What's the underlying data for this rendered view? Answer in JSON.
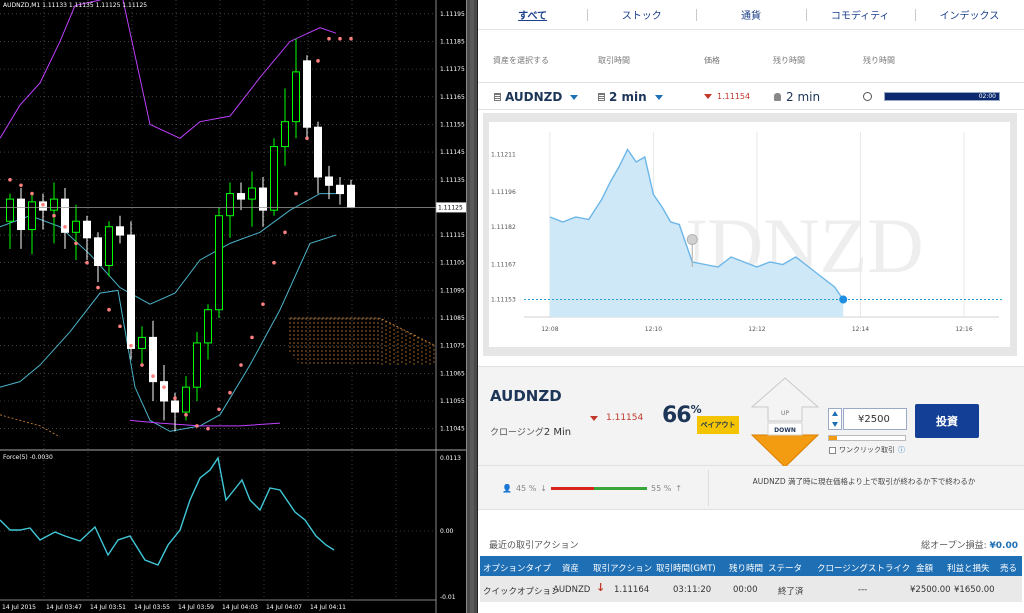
{
  "mt4": {
    "title": "AUDNZD,M1  1.11133 1.11135 1.11125 1.11125",
    "price_axis": [
      "1.11195",
      "1.11185",
      "1.11175",
      "1.11165",
      "1.11155",
      "1.11145",
      "1.11135",
      "1.11115",
      "1.11105",
      "1.11095",
      "1.11085",
      "1.11075",
      "1.11065",
      "1.11055",
      "1.11045"
    ],
    "current_price_tag": "1.11125",
    "indicator_label": "Force(5) -0.0030",
    "indicator_axis": [
      "0.0113",
      "0.00",
      "-0.01"
    ],
    "time_axis": [
      "14 Jul 2015",
      "14 Jul 03:47",
      "14 Jul 03:51",
      "14 Jul 03:55",
      "14 Jul 03:59",
      "14 Jul 04:03",
      "14 Jul 04:07",
      "14 Jul 04:11"
    ],
    "colors": {
      "bull": "#00ff00",
      "bear": "#ffffff",
      "bollinger_upper": "#c040ff",
      "bollinger_mid": "#4bb3c9",
      "sar": "#ff8080",
      "force": "#40c8d8",
      "cloud": "#d98a3a"
    },
    "candles": [
      {
        "o": 1.1112,
        "h": 1.1113,
        "l": 1.1111,
        "c": 1.11128
      },
      {
        "o": 1.11128,
        "h": 1.11132,
        "l": 1.1111,
        "c": 1.11117
      },
      {
        "o": 1.11117,
        "h": 1.1113,
        "l": 1.11108,
        "c": 1.11127
      },
      {
        "o": 1.11127,
        "h": 1.1113,
        "l": 1.11117,
        "c": 1.11124
      },
      {
        "o": 1.11124,
        "h": 1.11134,
        "l": 1.11112,
        "c": 1.11128
      },
      {
        "o": 1.11128,
        "h": 1.11132,
        "l": 1.1111,
        "c": 1.11116
      },
      {
        "o": 1.11116,
        "h": 1.11126,
        "l": 1.11106,
        "c": 1.1112
      },
      {
        "o": 1.1112,
        "h": 1.11122,
        "l": 1.11106,
        "c": 1.11114
      },
      {
        "o": 1.11114,
        "h": 1.11116,
        "l": 1.11098,
        "c": 1.11104
      },
      {
        "o": 1.11104,
        "h": 1.1112,
        "l": 1.111,
        "c": 1.11118
      },
      {
        "o": 1.11118,
        "h": 1.11122,
        "l": 1.11112,
        "c": 1.11115
      },
      {
        "o": 1.11115,
        "h": 1.1112,
        "l": 1.1107,
        "c": 1.11074
      },
      {
        "o": 1.11074,
        "h": 1.11082,
        "l": 1.11068,
        "c": 1.11078
      },
      {
        "o": 1.11078,
        "h": 1.11084,
        "l": 1.11055,
        "c": 1.11062
      },
      {
        "o": 1.11062,
        "h": 1.11068,
        "l": 1.11048,
        "c": 1.11055
      },
      {
        "o": 1.11055,
        "h": 1.11058,
        "l": 1.11044,
        "c": 1.11051
      },
      {
        "o": 1.11051,
        "h": 1.11064,
        "l": 1.11048,
        "c": 1.1106
      },
      {
        "o": 1.1106,
        "h": 1.1108,
        "l": 1.11055,
        "c": 1.11076
      },
      {
        "o": 1.11076,
        "h": 1.1109,
        "l": 1.1107,
        "c": 1.11088
      },
      {
        "o": 1.11088,
        "h": 1.11125,
        "l": 1.11085,
        "c": 1.11122
      },
      {
        "o": 1.11122,
        "h": 1.11134,
        "l": 1.11114,
        "c": 1.1113
      },
      {
        "o": 1.1113,
        "h": 1.11134,
        "l": 1.11124,
        "c": 1.11128
      },
      {
        "o": 1.11128,
        "h": 1.11138,
        "l": 1.11118,
        "c": 1.11132
      },
      {
        "o": 1.11132,
        "h": 1.11136,
        "l": 1.11118,
        "c": 1.11124
      },
      {
        "o": 1.11124,
        "h": 1.1115,
        "l": 1.11122,
        "c": 1.11147
      },
      {
        "o": 1.11147,
        "h": 1.11168,
        "l": 1.1114,
        "c": 1.11156
      },
      {
        "o": 1.11156,
        "h": 1.11186,
        "l": 1.1115,
        "c": 1.11174
      },
      {
        "o": 1.11178,
        "h": 1.1118,
        "l": 1.1115,
        "c": 1.11154
      },
      {
        "o": 1.11154,
        "h": 1.11156,
        "l": 1.1113,
        "c": 1.11136
      },
      {
        "o": 1.11136,
        "h": 1.1114,
        "l": 1.11128,
        "c": 1.11133
      },
      {
        "o": 1.11133,
        "h": 1.11136,
        "l": 1.11126,
        "c": 1.1113
      },
      {
        "o": 1.11133,
        "h": 1.11135,
        "l": 1.11125,
        "c": 1.11125
      }
    ],
    "sar": [
      1.11135,
      1.11133,
      1.1113,
      1.11126,
      1.11122,
      1.11118,
      1.11112,
      1.11105,
      1.11096,
      1.11088,
      1.11082,
      1.11075,
      1.11068,
      1.11064,
      1.1106,
      1.11056,
      1.1105,
      1.11046,
      1.11045,
      1.11052,
      1.11058,
      1.11068,
      1.11078,
      1.1109,
      1.11105,
      1.11116,
      1.1113,
      1.1115,
      1.11178,
      1.11186,
      1.11186,
      1.11186
    ]
  },
  "tabs": [
    {
      "label": "すべて",
      "active": true
    },
    {
      "label": "ストック",
      "active": false
    },
    {
      "label": "通貨",
      "active": false
    },
    {
      "label": "コモディティ",
      "active": false
    },
    {
      "label": "インデックス",
      "active": false
    }
  ],
  "header": {
    "asset": "資産を選択する",
    "period": "取引時間",
    "price": "価格",
    "remaining": "残り時間",
    "remaining2": "残り時間"
  },
  "selector": {
    "asset": "AUDNZD",
    "period": "2 min",
    "price": "1.11154",
    "remaining": "2 min",
    "timer": "02:00"
  },
  "chart_data": {
    "type": "area",
    "watermark": "AUDNZD",
    "yticks": [
      "1.11211",
      "1.11196",
      "1.11182",
      "1.11167",
      "1.11153"
    ],
    "xticks": [
      "12:08",
      "12:10",
      "12:12",
      "12:14",
      "12:16"
    ],
    "current_value": 1.11153,
    "x": [
      "12:08:00",
      "12:08:15",
      "12:08:30",
      "12:08:45",
      "12:09:00",
      "12:09:10",
      "12:09:20",
      "12:09:30",
      "12:09:40",
      "12:09:50",
      "12:10:00",
      "12:10:10",
      "12:10:20",
      "12:10:30",
      "12:10:45",
      "12:11:00",
      "12:11:15",
      "12:11:30",
      "12:11:45",
      "12:12:00",
      "12:12:15",
      "12:12:30",
      "12:12:45",
      "12:13:00",
      "12:13:15",
      "12:13:30",
      "12:13:40"
    ],
    "values": [
      1.11186,
      1.11184,
      1.11186,
      1.11185,
      1.11193,
      1.112,
      1.11206,
      1.11213,
      1.11208,
      1.1121,
      1.11195,
      1.1119,
      1.11184,
      1.11183,
      1.11168,
      1.11167,
      1.11166,
      1.1117,
      1.11168,
      1.11166,
      1.11168,
      1.11167,
      1.1117,
      1.11166,
      1.11162,
      1.11158,
      1.11153
    ]
  },
  "trade": {
    "symbol": "AUDNZD",
    "closing_label": "クロージング",
    "closing_value": "2 Min",
    "price": "1.11154",
    "payout_pct": "66",
    "payout_pct_sign": "%",
    "payout_label": "ペイアウト",
    "up_label": "UP",
    "down_label": "DOWN",
    "amount": "¥2500",
    "slider_fraction": 0.1,
    "oneclick_label": "ワンクリック取引",
    "invest_label": "投資"
  },
  "sentiment": {
    "put_pct": "45 %",
    "call_pct": "55 %",
    "put_fraction": 0.45,
    "text": "AUDNZD 満了時に現在価格より上で取引が終わるか下で終わるか"
  },
  "recent": {
    "title": "最近の取引アクション",
    "total_label": "総オープン損益:",
    "total_value": "¥0.00",
    "columns": [
      "オプションタイプ",
      "資産",
      "取引アクション",
      "取引時間(GMT)",
      "残り時間",
      "ステータ",
      "クロージングストライク",
      "金額",
      "利益と損失",
      "売る"
    ],
    "rows": [
      {
        "type": "クイックオプション",
        "asset": "AUDNZD",
        "action": "↓",
        "price": "1.11164",
        "time": "03:11:20",
        "remaining": "00:00",
        "status": "終了済",
        "strike": "---",
        "amount": "¥2500.00",
        "pnl": "¥1650.00",
        "sell": ""
      }
    ]
  }
}
